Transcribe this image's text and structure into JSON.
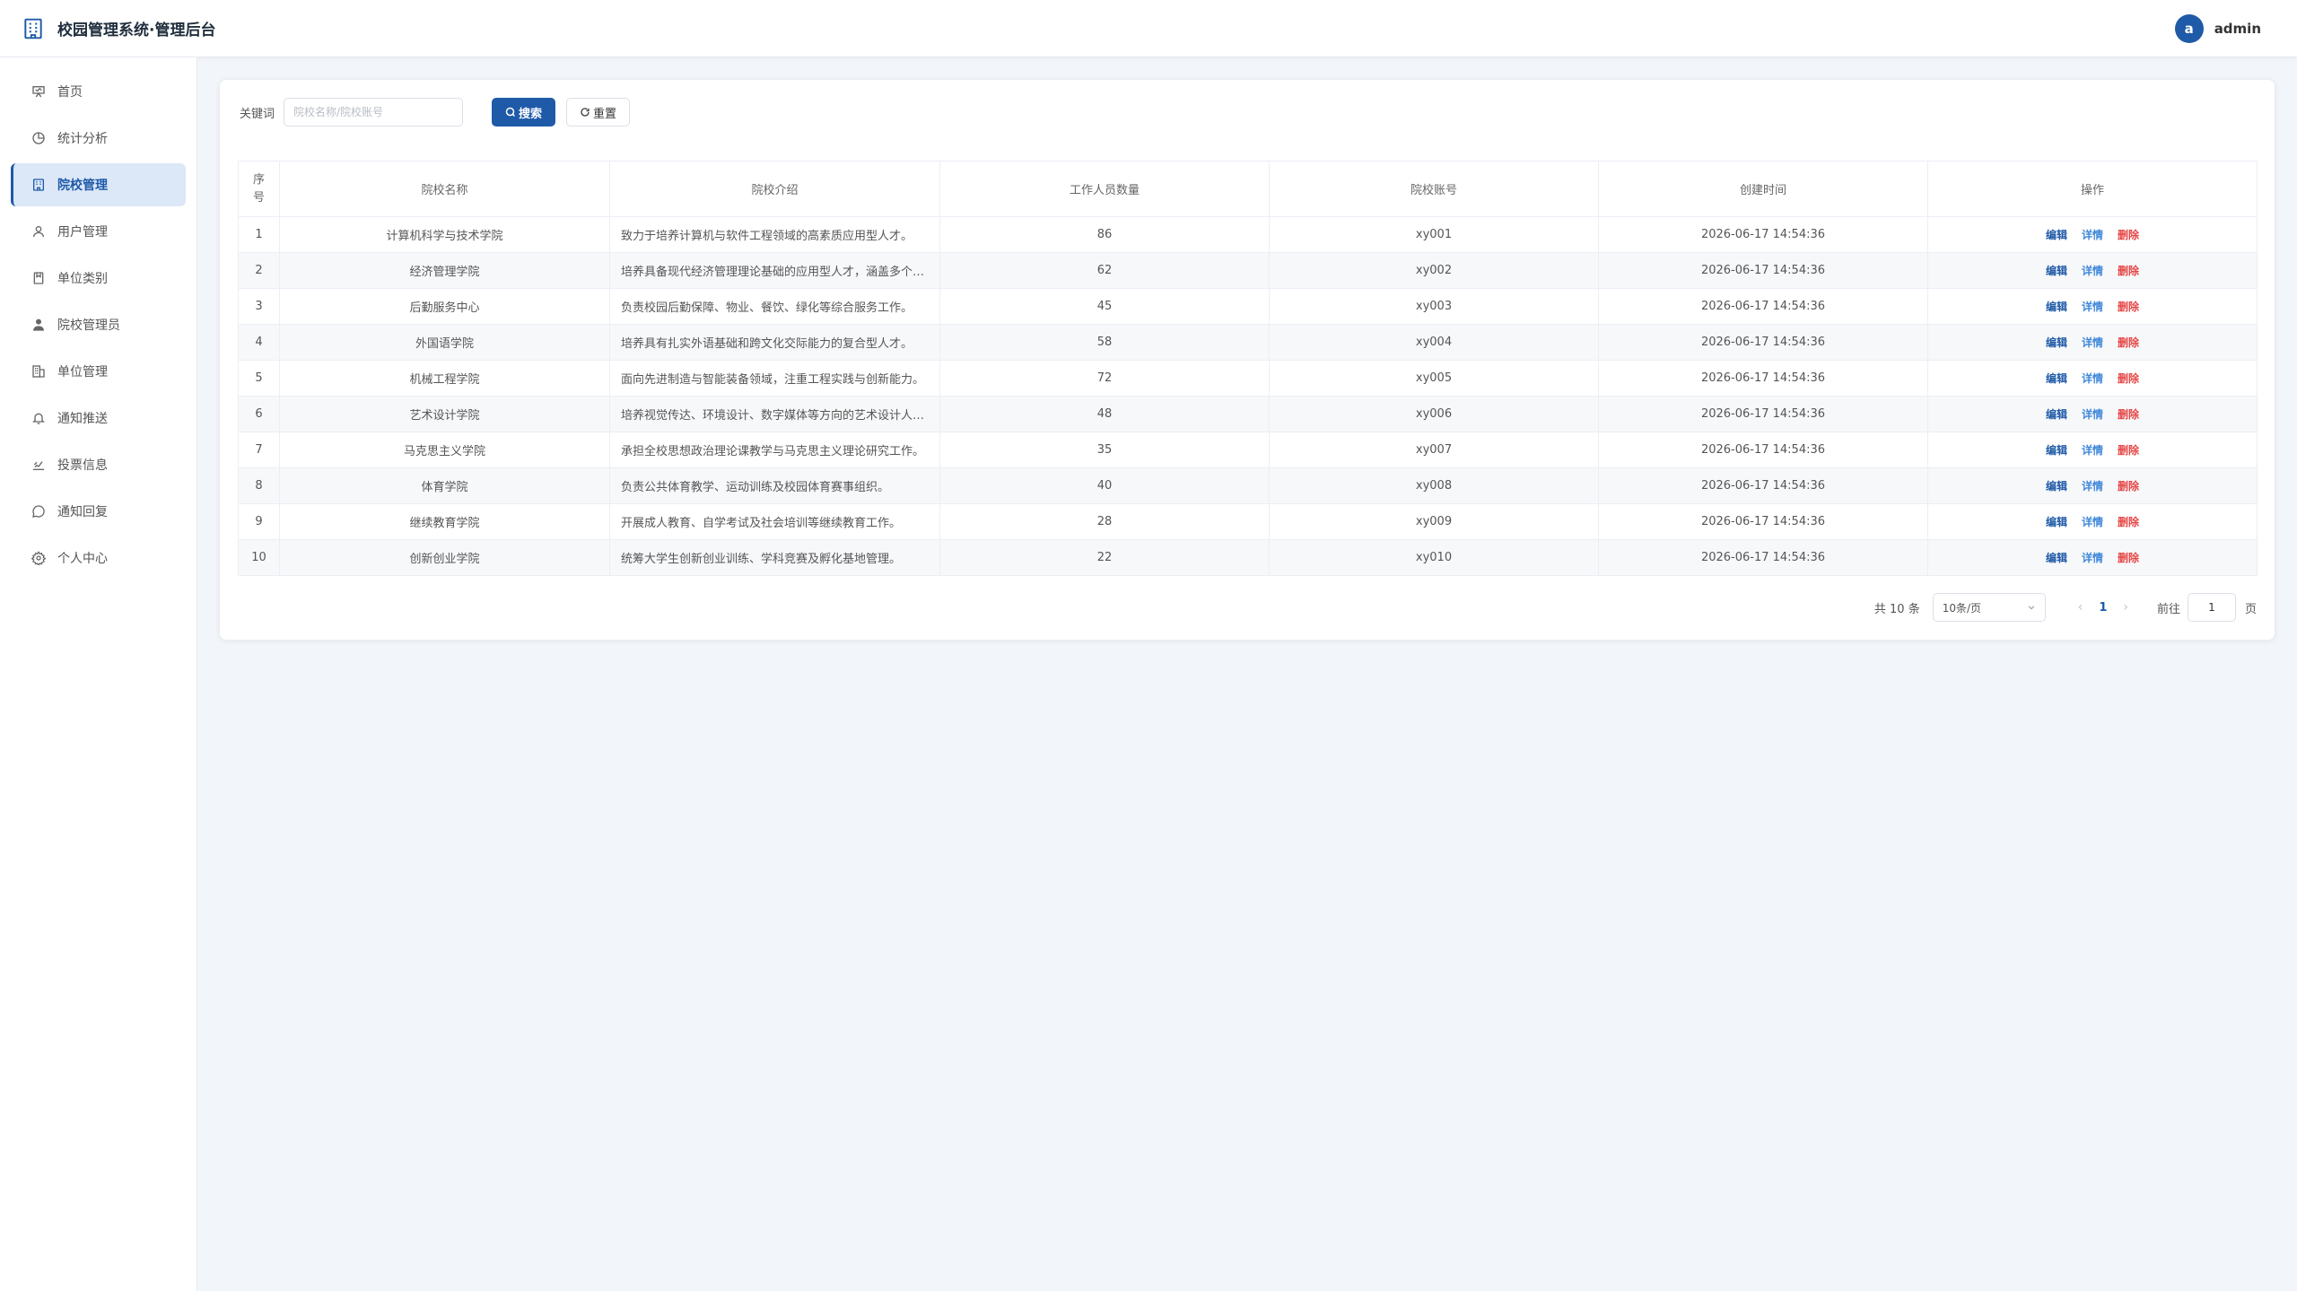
{
  "header": {
    "title": "校园管理系统·管理后台",
    "avatar_letter": "a",
    "username": "admin"
  },
  "sidebar": {
    "items": [
      {
        "label": "首页",
        "icon": "home-icon"
      },
      {
        "label": "统计分析",
        "icon": "chart-icon"
      },
      {
        "label": "院校管理",
        "icon": "building-icon",
        "active": true
      },
      {
        "label": "用户管理",
        "icon": "user-icon"
      },
      {
        "label": "单位类别",
        "icon": "category-icon"
      },
      {
        "label": "院校管理员",
        "icon": "admin-icon"
      },
      {
        "label": "单位管理",
        "icon": "office-icon"
      },
      {
        "label": "通知推送",
        "icon": "bell-icon"
      },
      {
        "label": "投票信息",
        "icon": "vote-icon"
      },
      {
        "label": "通知回复",
        "icon": "chat-icon"
      },
      {
        "label": "个人中心",
        "icon": "gear-icon"
      }
    ]
  },
  "search": {
    "label": "关键词",
    "placeholder": "院校名称/院校账号",
    "value": "",
    "search_button": "搜索",
    "reset_button": "重置"
  },
  "table": {
    "columns": [
      "序号",
      "院校名称",
      "院校介绍",
      "工作人员数量",
      "院校账号",
      "创建时间",
      "操作"
    ],
    "rows": [
      {
        "no": "1",
        "name": "计算机科学与技术学院",
        "desc": "致力于培养计算机与软件工程领域的高素质应用型人才。",
        "staff": "86",
        "account": "xy001",
        "created": "2026-06-17 14:54:36"
      },
      {
        "no": "2",
        "name": "经济管理学院",
        "desc": "培养具备现代经济管理理论基础的应用型人才，涵盖多个专业方向。",
        "staff": "62",
        "account": "xy002",
        "created": "2026-06-17 14:54:36"
      },
      {
        "no": "3",
        "name": "后勤服务中心",
        "desc": "负责校园后勤保障、物业、餐饮、绿化等综合服务工作。",
        "staff": "45",
        "account": "xy003",
        "created": "2026-06-17 14:54:36"
      },
      {
        "no": "4",
        "name": "外国语学院",
        "desc": "培养具有扎实外语基础和跨文化交际能力的复合型人才。",
        "staff": "58",
        "account": "xy004",
        "created": "2026-06-17 14:54:36"
      },
      {
        "no": "5",
        "name": "机械工程学院",
        "desc": "面向先进制造与智能装备领域，注重工程实践与创新能力。",
        "staff": "72",
        "account": "xy005",
        "created": "2026-06-17 14:54:36"
      },
      {
        "no": "6",
        "name": "艺术设计学院",
        "desc": "培养视觉传达、环境设计、数字媒体等方向的艺术设计人才。",
        "staff": "48",
        "account": "xy006",
        "created": "2026-06-17 14:54:36"
      },
      {
        "no": "7",
        "name": "马克思主义学院",
        "desc": "承担全校思想政治理论课教学与马克思主义理论研究工作。",
        "staff": "35",
        "account": "xy007",
        "created": "2026-06-17 14:54:36"
      },
      {
        "no": "8",
        "name": "体育学院",
        "desc": "负责公共体育教学、运动训练及校园体育赛事组织。",
        "staff": "40",
        "account": "xy008",
        "created": "2026-06-17 14:54:36"
      },
      {
        "no": "9",
        "name": "继续教育学院",
        "desc": "开展成人教育、自学考试及社会培训等继续教育工作。",
        "staff": "28",
        "account": "xy009",
        "created": "2026-06-17 14:54:36"
      },
      {
        "no": "10",
        "name": "创新创业学院",
        "desc": "统筹大学生创新创业训练、学科竞赛及孵化基地管理。",
        "staff": "22",
        "account": "xy010",
        "created": "2026-06-17 14:54:36"
      }
    ],
    "actions": {
      "edit": "编辑",
      "detail": "详情",
      "delete": "删除"
    }
  },
  "pagination": {
    "total": "共 10 条",
    "page_size": "10条/页",
    "current_page": "1",
    "goto_label": "前往",
    "goto_value": "1",
    "goto_suffix": "页"
  },
  "colors": {
    "primary": "#1f5aa8",
    "danger": "#e64545",
    "active_bg": "#dce8f8"
  }
}
